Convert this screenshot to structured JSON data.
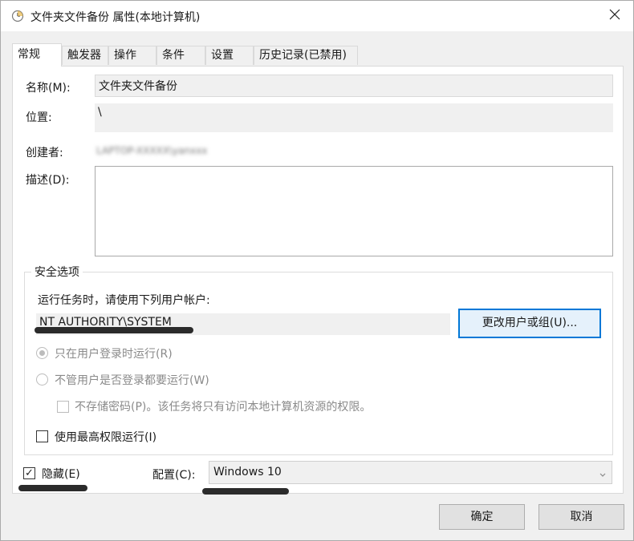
{
  "window": {
    "title": "文件夹文件备份 属性(本地计算机)"
  },
  "tabs": [
    {
      "label": "常规",
      "active": true
    },
    {
      "label": "触发器",
      "active": false
    },
    {
      "label": "操作",
      "active": false
    },
    {
      "label": "条件",
      "active": false
    },
    {
      "label": "设置",
      "active": false
    },
    {
      "label": "历史记录(已禁用)",
      "active": false
    }
  ],
  "general": {
    "name_label": "名称(M):",
    "name_value": "文件夹文件备份",
    "location_label": "位置:",
    "location_value": "\\",
    "author_label": "创建者:",
    "author_value": "LAPTOP-XXXXX\\yanxxx",
    "description_label": "描述(D):",
    "description_value": ""
  },
  "security": {
    "group_title": "安全选项",
    "run_as_prompt": "运行任务时，请使用下列用户帐户:",
    "account": "NT AUTHORITY\\SYSTEM",
    "change_user_button": "更改用户或组(U)...",
    "radio_logged_on": "只在用户登录时运行(R)",
    "radio_whether_logged": "不管用户是否登录都要运行(W)",
    "no_store_password": "不存储密码(P)。该任务将只有访问本地计算机资源的权限。",
    "highest_privileges": "使用最高权限运行(I)"
  },
  "footer": {
    "hidden_label": "隐藏(E)",
    "hidden_checked": true,
    "configure_label": "配置(C):",
    "configure_value": "Windows 10",
    "ok_button": "确定",
    "cancel_button": "取消"
  },
  "colors": {
    "accent": "#0078d7",
    "redaction": "#2b2b2b"
  }
}
